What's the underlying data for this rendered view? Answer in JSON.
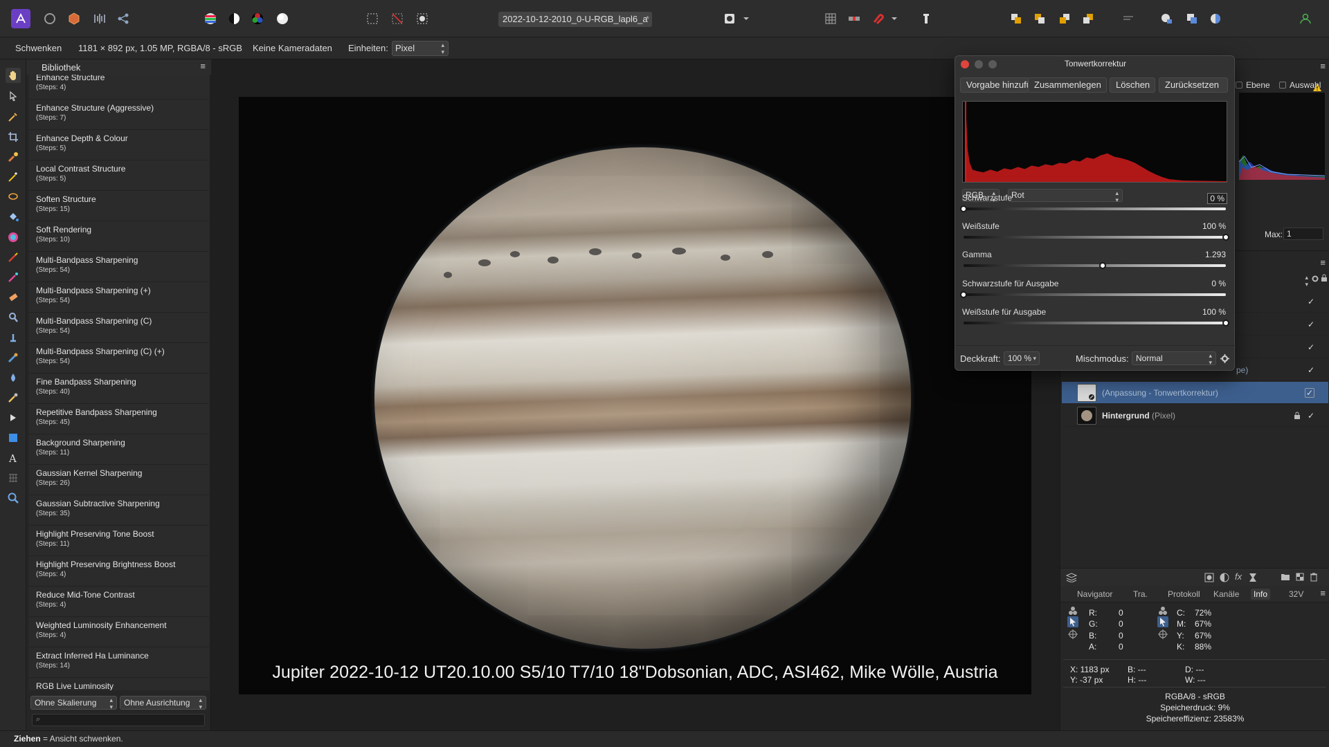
{
  "document": {
    "tab_title": "2022-10-12-2010_0-U-RGB_lapl6_a",
    "modified_mark": "*"
  },
  "context": {
    "tool_name": "Schwenken",
    "image_info": "1181 × 892 px, 1.05 MP, RGBA/8 - sRGB",
    "camera": "Keine Kameradaten",
    "units_label": "Einheiten:",
    "units_value": "Pixel"
  },
  "library": {
    "title": "Bibliothek",
    "items": [
      {
        "name": "Enhance Structure",
        "steps": "(Steps: 4)"
      },
      {
        "name": "Enhance Structure (Aggressive)",
        "steps": "(Steps: 7)"
      },
      {
        "name": "Enhance Depth & Colour",
        "steps": "(Steps: 5)"
      },
      {
        "name": "Local Contrast Structure",
        "steps": "(Steps: 5)"
      },
      {
        "name": "Soften Structure",
        "steps": "(Steps: 15)"
      },
      {
        "name": "Soft Rendering",
        "steps": "(Steps: 10)"
      },
      {
        "name": "Multi-Bandpass Sharpening",
        "steps": "(Steps: 54)"
      },
      {
        "name": "Multi-Bandpass Sharpening (+)",
        "steps": "(Steps: 54)"
      },
      {
        "name": "Multi-Bandpass Sharpening (C)",
        "steps": "(Steps: 54)"
      },
      {
        "name": "Multi-Bandpass Sharpening (C) (+)",
        "steps": "(Steps: 54)"
      },
      {
        "name": "Fine Bandpass Sharpening",
        "steps": "(Steps: 40)"
      },
      {
        "name": "Repetitive Bandpass Sharpening",
        "steps": "(Steps: 45)"
      },
      {
        "name": "Background Sharpening",
        "steps": "(Steps: 11)"
      },
      {
        "name": "Gaussian Kernel Sharpening",
        "steps": "(Steps: 26)"
      },
      {
        "name": "Gaussian Subtractive Sharpening",
        "steps": "(Steps: 35)"
      },
      {
        "name": "Highlight Preserving Tone Boost",
        "steps": "(Steps: 11)"
      },
      {
        "name": "Highlight Preserving Brightness Boost",
        "steps": "(Steps: 4)"
      },
      {
        "name": "Reduce Mid-Tone Contrast",
        "steps": "(Steps: 4)"
      },
      {
        "name": "Weighted Luminosity Enhancement",
        "steps": "(Steps: 4)"
      },
      {
        "name": "Extract Inferred Ha Luminance",
        "steps": "(Steps: 14)"
      },
      {
        "name": "RGB Live Luminosity",
        "steps": ""
      }
    ],
    "scaling": "Ohne Skalierung",
    "alignment": "Ohne Ausrichtung"
  },
  "canvas": {
    "caption": "Jupiter 2022-10-12 UT20.10.00 S5/10 T7/10 18\"Dobsonian, ADC, ASI462, Mike Wölle, Austria"
  },
  "histogram_panel": {
    "layer_check": "Ebene",
    "selection_check": "Auswahl",
    "max_label": "Max:",
    "max_value": "1"
  },
  "layers": {
    "partial_suffix": "pe)",
    "adjustment_name": "(Anpassung - Tonwertkorrektur)",
    "background_name": "Hintergrund",
    "background_type": "(Pixel)",
    "check_mark": "✓"
  },
  "info_tabs": [
    "Navigator",
    "Tra.",
    "Protokoll",
    "Kanäle",
    "Info",
    "32V"
  ],
  "info": {
    "rgba": [
      {
        "label": "R:",
        "value": "0"
      },
      {
        "label": "G:",
        "value": "0"
      },
      {
        "label": "B:",
        "value": "0"
      },
      {
        "label": "A:",
        "value": "0"
      }
    ],
    "cmyk": [
      {
        "label": "C:",
        "value": "72%"
      },
      {
        "label": "M:",
        "value": "67%"
      },
      {
        "label": "Y:",
        "value": "67%"
      },
      {
        "label": "K:",
        "value": "88%"
      }
    ],
    "x": "X: 1183 px",
    "y": "Y: -37 px",
    "b": "B: ---",
    "h": "H: ---",
    "d": "D: ---",
    "w": "W: ---",
    "format": "RGBA/8 - sRGB",
    "memory": "Speicherdruck: 9%",
    "efficiency": "Speichereffizienz: 23583%"
  },
  "levels_dialog": {
    "title": "Tonwertkorrektur",
    "buttons": {
      "add_preset": "Vorgabe hinzufügen",
      "merge": "Zusammenlegen",
      "delete": "Löschen",
      "reset": "Zurücksetzen"
    },
    "channel_mode": "RGB",
    "channel": "Rot",
    "sliders": [
      {
        "label": "Schwarzstufe",
        "value": "0 %",
        "position": 0
      },
      {
        "label": "Weißstufe",
        "value": "100 %",
        "position": 1
      },
      {
        "label": "Gamma",
        "value": "1.293",
        "position": 0.53
      },
      {
        "label": "Schwarzstufe für Ausgabe",
        "value": "0 %",
        "position": 0
      },
      {
        "label": "Weißstufe für Ausgabe",
        "value": "100 %",
        "position": 1
      }
    ],
    "opacity_label": "Deckkraft:",
    "opacity_value": "100 %",
    "blend_label": "Mischmodus:",
    "blend_value": "Normal"
  },
  "status": {
    "key": "Ziehen",
    "text": " = Ansicht schwenken."
  },
  "colors": {
    "accent_selection": "#3d5f8e",
    "close_light": "#e0443e",
    "histogram_red": "#b01818"
  }
}
